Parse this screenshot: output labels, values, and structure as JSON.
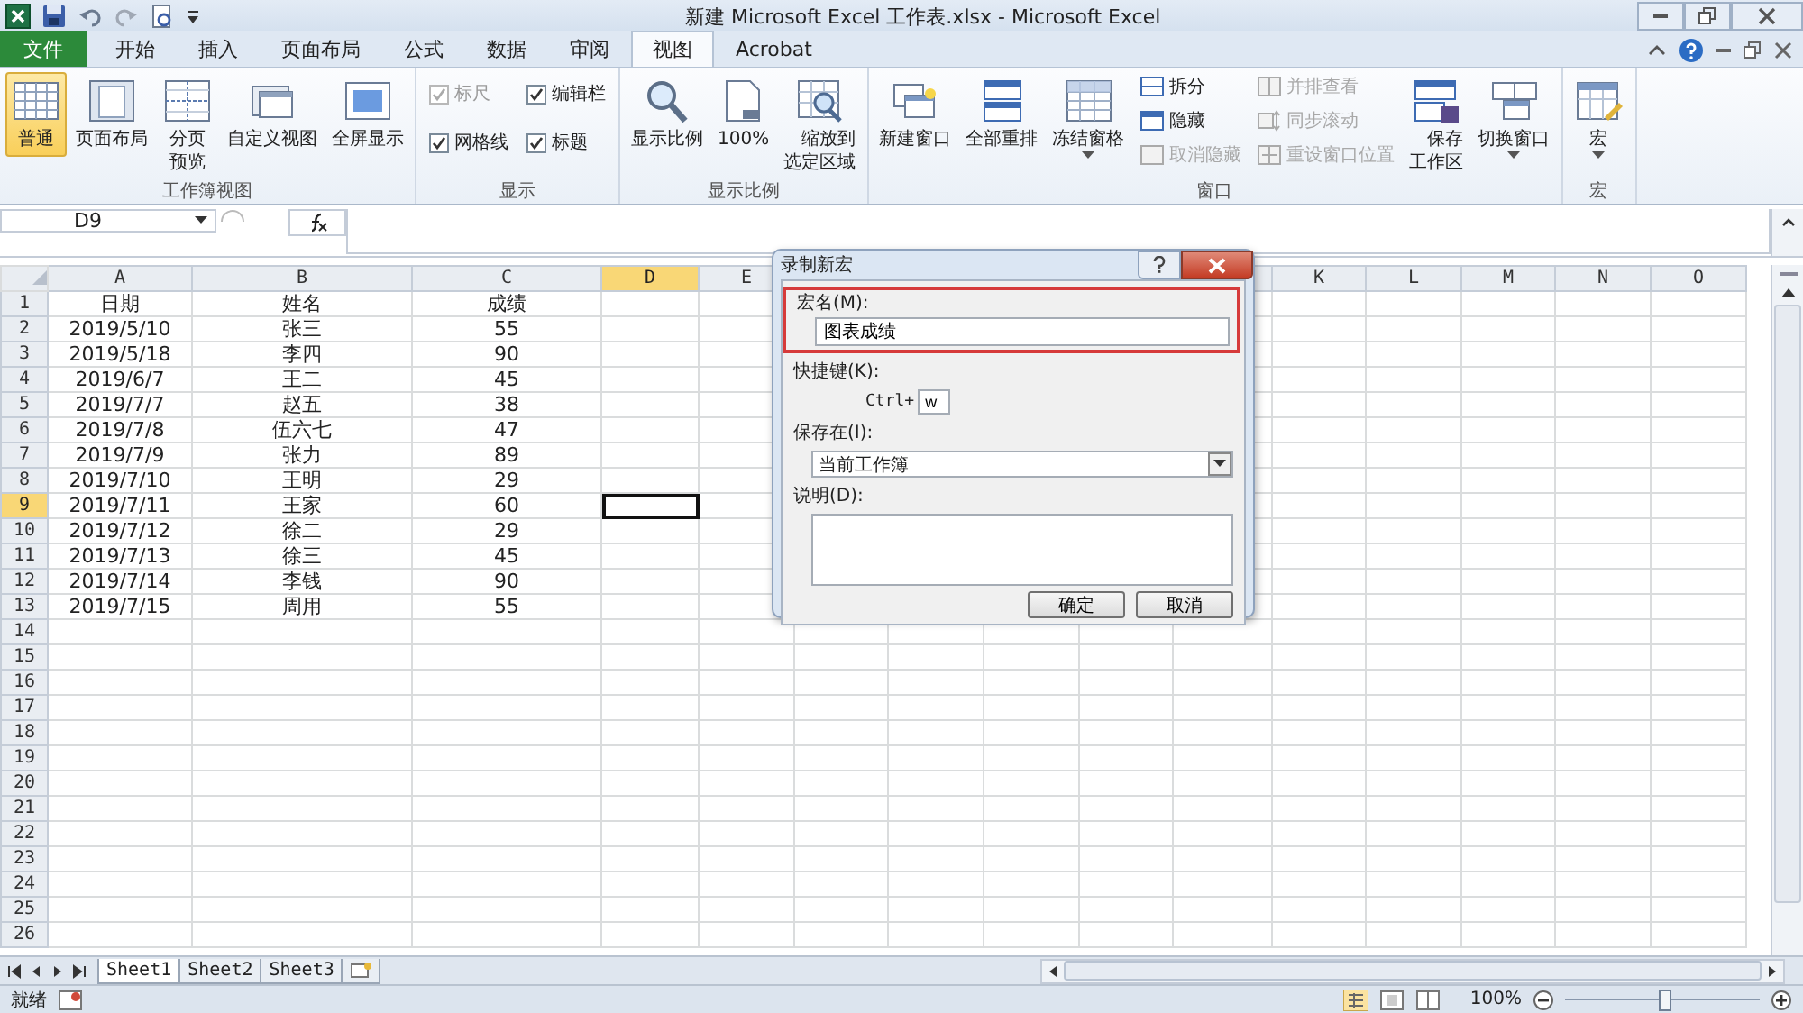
{
  "window": {
    "title": "新建 Microsoft Excel 工作表.xlsx - Microsoft Excel"
  },
  "tabs": [
    {
      "label": "文件",
      "kind": "file",
      "selected": false
    },
    {
      "label": "开始",
      "kind": "tab",
      "selected": false
    },
    {
      "label": "插入",
      "kind": "tab",
      "selected": false
    },
    {
      "label": "页面布局",
      "kind": "tab",
      "selected": false
    },
    {
      "label": "公式",
      "kind": "tab",
      "selected": false
    },
    {
      "label": "数据",
      "kind": "tab",
      "selected": false
    },
    {
      "label": "审阅",
      "kind": "tab",
      "selected": false
    },
    {
      "label": "视图",
      "kind": "tab",
      "selected": true
    },
    {
      "label": "Acrobat",
      "kind": "tab",
      "selected": false
    }
  ],
  "ribbon": {
    "groups": [
      {
        "label": "工作簿视图",
        "columns": [
          [
            {
              "kind": "large",
              "label": "普通",
              "selected": true
            }
          ],
          [
            {
              "kind": "large",
              "label": "页面布局",
              "selected": false
            }
          ],
          [
            {
              "kind": "large",
              "label": "分页预览",
              "two_lines": true,
              "selected": false
            }
          ],
          [
            {
              "kind": "large",
              "label": "自定义视图",
              "selected": false
            }
          ],
          [
            {
              "kind": "large",
              "label": "全屏显示",
              "selected": false
            }
          ]
        ]
      },
      {
        "label": "显示",
        "columns": [
          [
            {
              "kind": "check",
              "label": "标尺",
              "checked": true,
              "disabled": true
            },
            {
              "kind": "check",
              "label": "网格线",
              "checked": true,
              "disabled": false
            }
          ],
          [
            {
              "kind": "check",
              "label": "编辑栏",
              "checked": true,
              "disabled": false
            },
            {
              "kind": "check",
              "label": "标题",
              "checked": true,
              "disabled": false
            }
          ]
        ]
      },
      {
        "label": "显示比例",
        "columns": [
          [
            {
              "kind": "large",
              "label": "显示比例",
              "selected": false
            }
          ],
          [
            {
              "kind": "large",
              "label": "100%",
              "selected": false
            }
          ],
          [
            {
              "kind": "large",
              "label": "缩放到选定区域",
              "two_lines": true,
              "selected": false
            }
          ]
        ]
      },
      {
        "label": "窗口",
        "columns": [
          [
            {
              "kind": "large",
              "label": "新建窗口",
              "selected": false
            }
          ],
          [
            {
              "kind": "large",
              "label": "全部重排",
              "selected": false
            }
          ],
          [
            {
              "kind": "large",
              "label": "冻结窗格",
              "selected": false,
              "dropdown": true
            }
          ],
          [
            {
              "kind": "small",
              "label": "拆分",
              "disabled": false
            },
            {
              "kind": "small",
              "label": "隐藏",
              "disabled": false
            },
            {
              "kind": "small",
              "label": "取消隐藏",
              "disabled": true
            }
          ],
          [
            {
              "kind": "small",
              "label": "并排查看",
              "disabled": true
            },
            {
              "kind": "small",
              "label": "同步滚动",
              "disabled": true
            },
            {
              "kind": "small",
              "label": "重设窗口位置",
              "disabled": true
            }
          ],
          [
            {
              "kind": "large",
              "label": "保存工作区",
              "two_lines": true,
              "selected": false
            }
          ],
          [
            {
              "kind": "large",
              "label": "切换窗口",
              "selected": false,
              "dropdown": true
            }
          ]
        ]
      },
      {
        "label": "宏",
        "columns": [
          [
            {
              "kind": "large",
              "label": "宏",
              "selected": false,
              "dropdown": true
            }
          ]
        ]
      }
    ]
  },
  "formula_bar": {
    "name_box": "D9"
  },
  "sheet": {
    "columns": [
      {
        "label": "A",
        "selected": false
      },
      {
        "label": "B",
        "selected": false
      },
      {
        "label": "C",
        "selected": false
      },
      {
        "label": "D",
        "selected": true
      },
      {
        "label": "E",
        "selected": false
      },
      {},
      {},
      {},
      {},
      {},
      {
        "label": "K",
        "selected": false
      },
      {
        "label": "L",
        "selected": false
      },
      {
        "label": "M",
        "selected": false
      },
      {
        "label": "N",
        "selected": false
      },
      {
        "label": "O",
        "selected": false
      }
    ],
    "rows": [
      {
        "number": "1",
        "selected": false,
        "cells": [
          "日期",
          "姓名",
          "成绩"
        ]
      },
      {
        "number": "2",
        "selected": false,
        "cells": [
          "2019/5/10",
          "张三",
          "55"
        ]
      },
      {
        "number": "3",
        "selected": false,
        "cells": [
          "2019/5/18",
          "李四",
          "90"
        ]
      },
      {
        "number": "4",
        "selected": false,
        "cells": [
          "2019/6/7",
          "王二",
          "45"
        ]
      },
      {
        "number": "5",
        "selected": false,
        "cells": [
          "2019/7/7",
          "赵五",
          "38"
        ]
      },
      {
        "number": "6",
        "selected": false,
        "cells": [
          "2019/7/8",
          "伍六七",
          "47"
        ]
      },
      {
        "number": "7",
        "selected": false,
        "cells": [
          "2019/7/9",
          "张力",
          "89"
        ]
      },
      {
        "number": "8",
        "selected": false,
        "cells": [
          "2019/7/10",
          "王明",
          "29"
        ]
      },
      {
        "number": "9",
        "selected": true,
        "cells": [
          "2019/7/11",
          "王家",
          "60"
        ]
      },
      {
        "number": "10",
        "selected": false,
        "cells": [
          "2019/7/12",
          "徐二",
          "29"
        ]
      },
      {
        "number": "11",
        "selected": false,
        "cells": [
          "2019/7/13",
          "徐三",
          "45"
        ]
      },
      {
        "number": "12",
        "selected": false,
        "cells": [
          "2019/7/14",
          "李钱",
          "90"
        ]
      },
      {
        "number": "13",
        "selected": false,
        "cells": [
          "2019/7/15",
          "周用",
          "55"
        ]
      },
      {
        "number": "14",
        "selected": false
      },
      {
        "number": "15",
        "selected": false
      },
      {
        "number": "16",
        "selected": false
      },
      {
        "number": "17",
        "selected": false
      },
      {
        "number": "18",
        "selected": false
      },
      {
        "number": "19",
        "selected": false
      },
      {
        "number": "20",
        "selected": false
      },
      {
        "number": "21",
        "selected": false
      },
      {
        "number": "22",
        "selected": false
      },
      {
        "number": "23",
        "selected": false
      },
      {
        "number": "24",
        "selected": false
      },
      {
        "number": "25",
        "selected": false
      },
      {
        "number": "26",
        "selected": false
      }
    ]
  },
  "dialog": {
    "title": "录制新宏",
    "name_label": "宏名(M):",
    "name_value": "图表成绩",
    "name_highlighted": true,
    "shortcut_label": "快捷键(K):",
    "shortcut_prefix": "Ctrl+",
    "shortcut_value": "w",
    "store_label": "保存在(I):",
    "store_value": "当前工作簿",
    "description_label": "说明(D):",
    "buttons": [
      "确定",
      "取消"
    ]
  },
  "sheet_tabs": [
    {
      "label": "Sheet1",
      "selected": true
    },
    {
      "label": "Sheet2",
      "selected": false
    },
    {
      "label": "Sheet3",
      "selected": false
    }
  ],
  "status_bar": {
    "status": "就绪",
    "zoom": "100%",
    "zoom_slider": {
      "level": 0.5
    }
  }
}
